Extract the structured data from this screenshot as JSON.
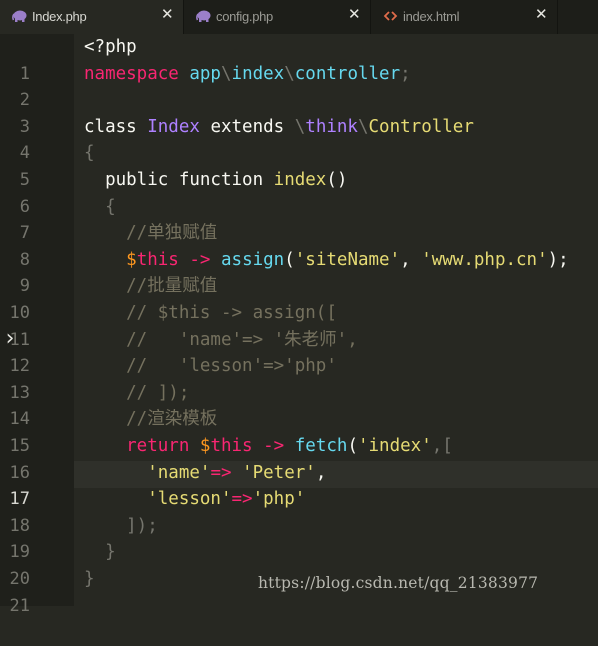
{
  "tabs": [
    {
      "label": "Index.php",
      "icon": "php-elephant-icon",
      "active": true
    },
    {
      "label": "config.php",
      "icon": "php-elephant-icon",
      "active": false
    },
    {
      "label": "index.html",
      "icon": "html-code-icon",
      "active": false
    }
  ],
  "close_symbol": "✕",
  "current_line": 17,
  "line_numbers": [
    "1",
    "2",
    "3",
    "4",
    "5",
    "6",
    "7",
    "8",
    "9",
    "10",
    "11",
    "12",
    "13",
    "14",
    "15",
    "16",
    "17",
    "18",
    "19",
    "20",
    "21"
  ],
  "code": {
    "l1": {
      "t1": "<?php"
    },
    "l2": {
      "t1": "namespace",
      "t2": " app",
      "t3": "\\",
      "t4": "index",
      "t5": "\\",
      "t6": "controller",
      "t7": ";"
    },
    "l4": {
      "t1": "class ",
      "t2": "Index",
      "t3": " extends ",
      "t4": "\\",
      "t5": "think",
      "t6": "\\",
      "t7": "Controller"
    },
    "l5": {
      "t1": "{"
    },
    "l6": {
      "t1": "  public function ",
      "t2": "index",
      "t3": "()"
    },
    "l7": {
      "t1": "  {"
    },
    "l8": {
      "t1": "    //单独赋值"
    },
    "l9": {
      "t1": "    $",
      "t2": "this",
      "t3": " -> ",
      "t4": "assign",
      "t5": "(",
      "t6": "'siteName'",
      "t7": ", ",
      "t8": "'www.php.cn'",
      "t9": ");"
    },
    "l10": {
      "t1": "    //批量赋值"
    },
    "l11": {
      "t1": "    // $this -> assign(["
    },
    "l12": {
      "t1": "    //   'name'=> '朱老师',"
    },
    "l13": {
      "t1": "    //   'lesson'=>'php'"
    },
    "l14": {
      "t1": "    // ]);"
    },
    "l15": {
      "t1": "    //渲染模板"
    },
    "l16": {
      "t1": "    return",
      "t2": " $",
      "t3": "this",
      "t4": " -> ",
      "t5": "fetch",
      "t6": "(",
      "t7": "'index'",
      "t8": ",["
    },
    "l17": {
      "t1": "      ",
      "t2": "'name'",
      "t3": "=>",
      "t4": " 'Peter'",
      "t5": ","
    },
    "l18": {
      "t1": "      ",
      "t2": "'lesson'",
      "t3": "=>",
      "t4": "'php'"
    },
    "l19": {
      "t1": "    ]);"
    },
    "l20": {
      "t1": "  }"
    },
    "l21": {
      "t1": "}"
    }
  },
  "fold_arrow": "›",
  "watermark": "https://blog.csdn.net/qq_21383977",
  "colors": {
    "background": "#272822",
    "gutter": "#1f201b",
    "tabbar": "#1d1e19",
    "keyword": "#f92672",
    "string": "#e6db74",
    "class": "#a6e22e",
    "namespace": "#66d9ef",
    "comment": "#75715e"
  }
}
